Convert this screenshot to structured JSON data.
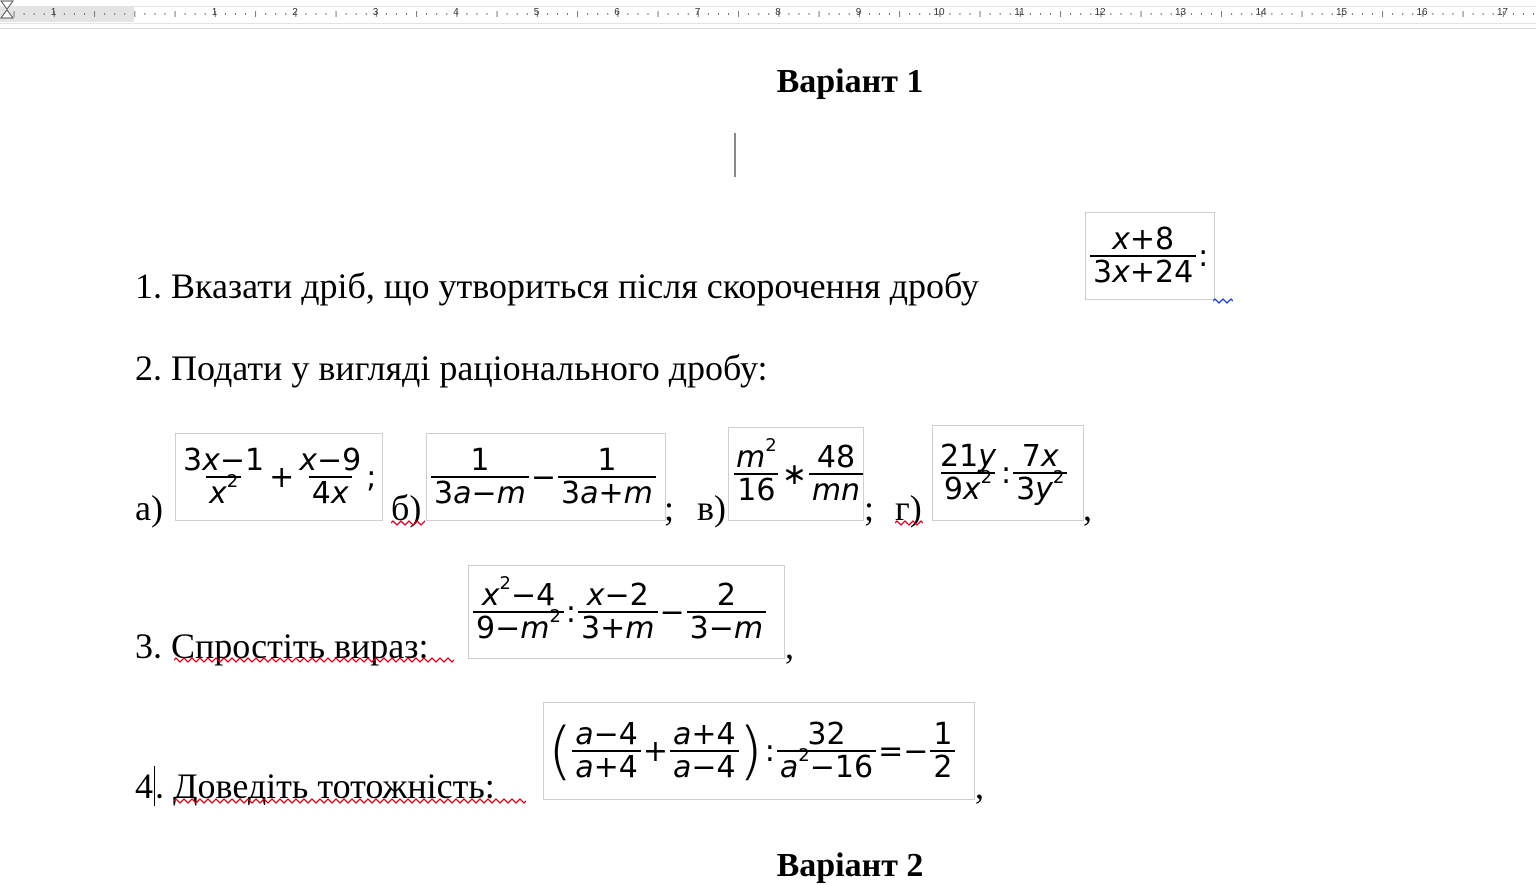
{
  "ruler": {
    "numbers": [
      "1",
      "1",
      "2",
      "3",
      "4",
      "5",
      "6",
      "7",
      "8",
      "9",
      "10",
      "11",
      "12",
      "13",
      "14",
      "15",
      "16",
      "17"
    ]
  },
  "document": {
    "title": "Варіант 1",
    "title_next": "Варіант 2",
    "task1": {
      "text": "1. Вказати дріб, що утвориться після скорочення дробу",
      "formula": {
        "num": "x+8",
        "den": "3x+24",
        "tail": ":"
      }
    },
    "task2": {
      "text": "2. Подати у вигляді раціонального дробу:",
      "labels": {
        "a": "а)",
        "b": "б)",
        "v": "в)",
        "g": "г)"
      },
      "sep": ";",
      "end": ","
    },
    "task3": {
      "text": "3. Спростіть вираз:",
      "end": ","
    },
    "task4": {
      "text_num": "4",
      "text": ". Доведіть тотожність:",
      "end": ","
    }
  },
  "colors": {
    "spell_underline": "#d0021b",
    "grammar_underline": "#1a3fbf"
  }
}
